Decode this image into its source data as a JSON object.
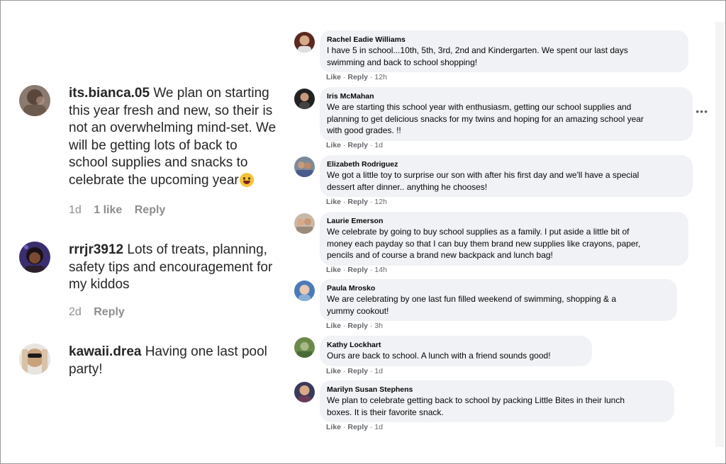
{
  "instagram_comments": [
    {
      "username": "its.bianca.05",
      "text": " We plan on starting this year fresh and new, so their is not an overwhelming mind-set. We will be getting lots of back to school supplies and snacks to celebrate the upcoming year",
      "emoji": "yum-face-emoji",
      "time": "1d",
      "likes": "1 like",
      "reply": "Reply"
    },
    {
      "username": "rrrjr3912",
      "text": " Lots of treats, planning, safety tips and encouragement for my kiddos",
      "time": "2d",
      "reply": "Reply"
    },
    {
      "username": "kawaii.drea",
      "text": " Having one last pool party!"
    }
  ],
  "facebook_comments": [
    {
      "name": "Rachel Eadie Williams",
      "lines": [
        "I have 5 in school...10th, 5th, 3rd, 2nd and Kindergarten. We spent our last days",
        "swimming and back to school shopping!"
      ],
      "like": "Like",
      "reply": "Reply",
      "time": "12h"
    },
    {
      "name": "Iris McMahan",
      "lines": [
        "We are starting this school year with enthusiasm, getting our school supplies and",
        "planning to get delicious snacks for my twins and hoping for an amazing school year",
        "with good grades. !!"
      ],
      "like": "Like",
      "reply": "Reply",
      "time": "1d"
    },
    {
      "name": "Elizabeth Rodriguez",
      "lines": [
        "We got a little toy to surprise our son with after his first day and we'll have a special",
        "dessert after dinner.. anything he chooses!"
      ],
      "like": "Like",
      "reply": "Reply",
      "time": "12h"
    },
    {
      "name": "Laurie Emerson",
      "lines": [
        "We celebrate by going to buy school supplies as a family. I put aside a little bit of",
        "money each payday so that I can buy them brand new supplies like crayons, paper,",
        "pencils and of course a brand new backpack and lunch bag!"
      ],
      "like": "Like",
      "reply": "Reply",
      "time": "14h"
    },
    {
      "name": "Paula Mrosko",
      "lines": [
        "We are celebrating by one last fun filled weekend of swimming, shopping & a",
        "yummy cookout!"
      ],
      "like": "Like",
      "reply": "Reply",
      "time": "3h"
    },
    {
      "name": "Kathy Lockhart",
      "lines": [
        "Ours are back to school. A lunch with a friend sounds good!"
      ],
      "like": "Like",
      "reply": "Reply",
      "time": "1d"
    },
    {
      "name": "Marilyn Susan Stephens",
      "lines": [
        "We plan to celebrate getting back to school by packing Little Bites in their lunch",
        "boxes. It is their favorite snack."
      ],
      "like": "Like",
      "reply": "Reply",
      "time": "1d"
    }
  ],
  "more_options_label": "•••",
  "colors": {
    "bubble": "#f0f2f5",
    "meta": "#65676b",
    "ig_meta": "#8e8e8e"
  }
}
